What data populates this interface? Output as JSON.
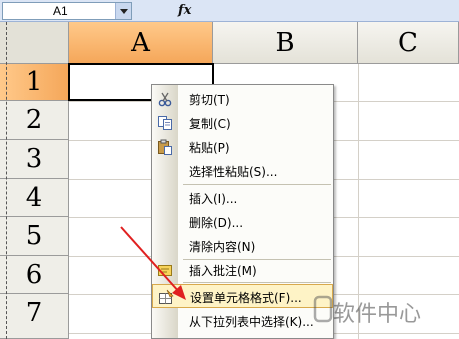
{
  "formula_bar": {
    "name_box": "A1",
    "fx_label": "fx"
  },
  "columns": [
    "A",
    "B",
    "C"
  ],
  "rows": [
    "1",
    "2",
    "3",
    "4",
    "5",
    "6",
    "7"
  ],
  "selected_cell": "A1",
  "context_menu": {
    "items": [
      {
        "label": "剪切(T)",
        "icon": "scissors-icon"
      },
      {
        "label": "复制(C)",
        "icon": "copy-icon"
      },
      {
        "label": "粘贴(P)",
        "icon": "paste-icon"
      },
      {
        "label": "选择性粘贴(S)..."
      },
      {
        "label": "插入(I)..."
      },
      {
        "label": "删除(D)..."
      },
      {
        "label": "清除内容(N)"
      },
      {
        "label": "插入批注(M)",
        "icon": "comment-icon"
      },
      {
        "label": "设置单元格格式(F)...",
        "icon": "format-cells-icon",
        "highlighted": true
      },
      {
        "label": "从下拉列表中选择(K)..."
      }
    ]
  },
  "watermark": {
    "text": "软件中心"
  },
  "colors": {
    "header_selected": "#f5a75a",
    "menu_highlight": "#fef3c6",
    "arrow": "#e02020"
  }
}
